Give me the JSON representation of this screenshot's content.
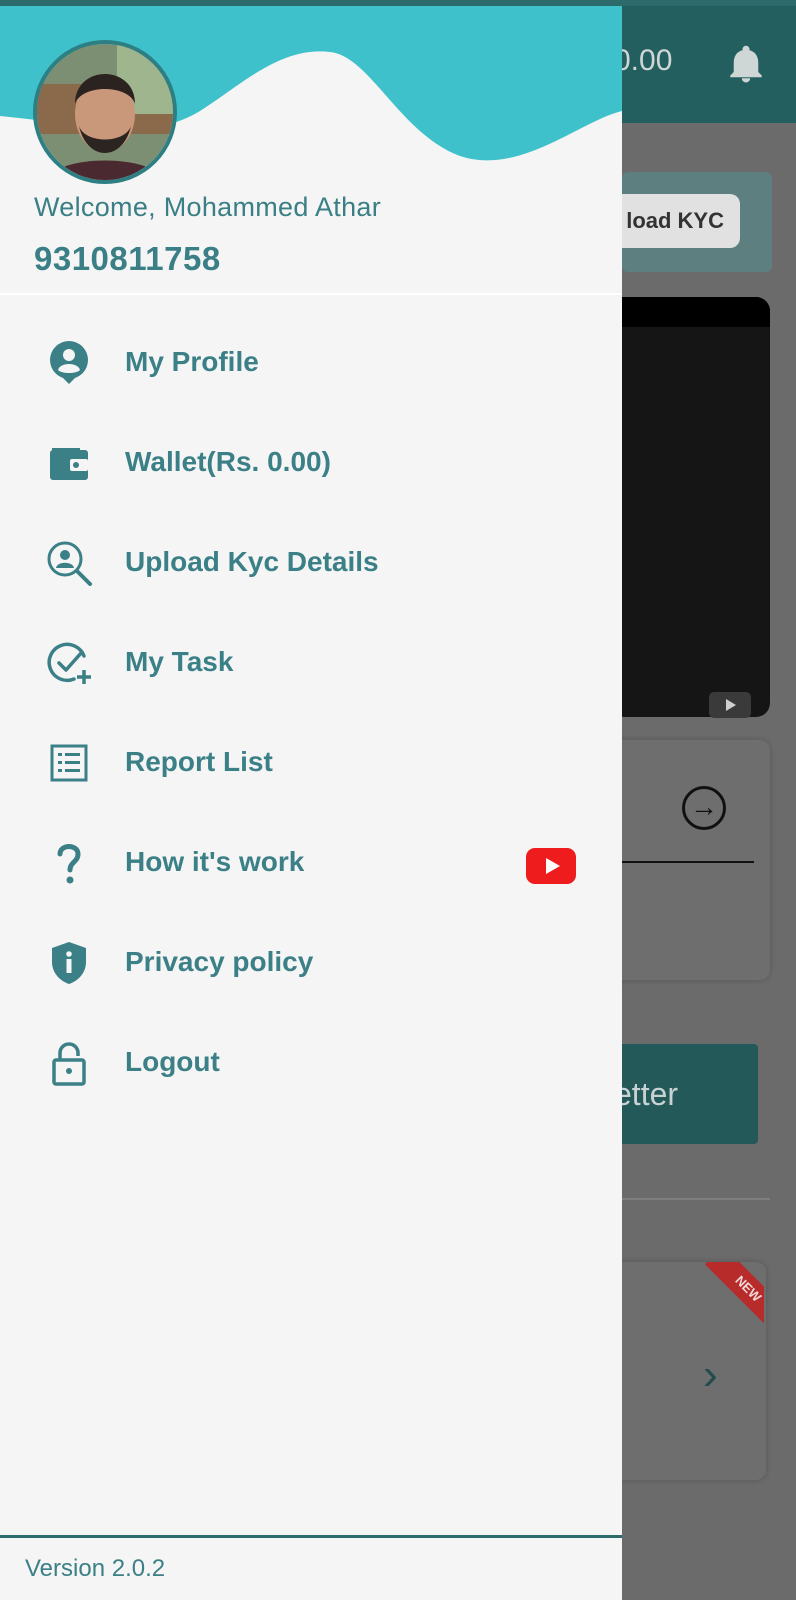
{
  "background_app": {
    "balance_text": "0.00",
    "kyc_button_label": "load KYC",
    "letter_button_label": "etter",
    "new_ribbon": "NEW"
  },
  "drawer": {
    "welcome_text": "Welcome, Mohammed Athar",
    "phone_number": "9310811758",
    "menu": [
      {
        "label": "My Profile",
        "icon": "profile-icon"
      },
      {
        "label": "Wallet(Rs. 0.00)",
        "icon": "wallet-icon"
      },
      {
        "label": "Upload Kyc Details",
        "icon": "kyc-search-icon"
      },
      {
        "label": "My Task",
        "icon": "task-check-icon"
      },
      {
        "label": "Report List",
        "icon": "report-list-icon"
      },
      {
        "label": "How it's work",
        "icon": "question-icon",
        "badge": "youtube-icon"
      },
      {
        "label": "Privacy policy",
        "icon": "shield-info-icon"
      },
      {
        "label": "Logout",
        "icon": "lock-icon"
      }
    ],
    "version_text": "Version  2.0.2"
  },
  "colors": {
    "accent": "#3b7f87",
    "wave": "#3fc1cb",
    "dark_teal": "#2c6a6c"
  }
}
